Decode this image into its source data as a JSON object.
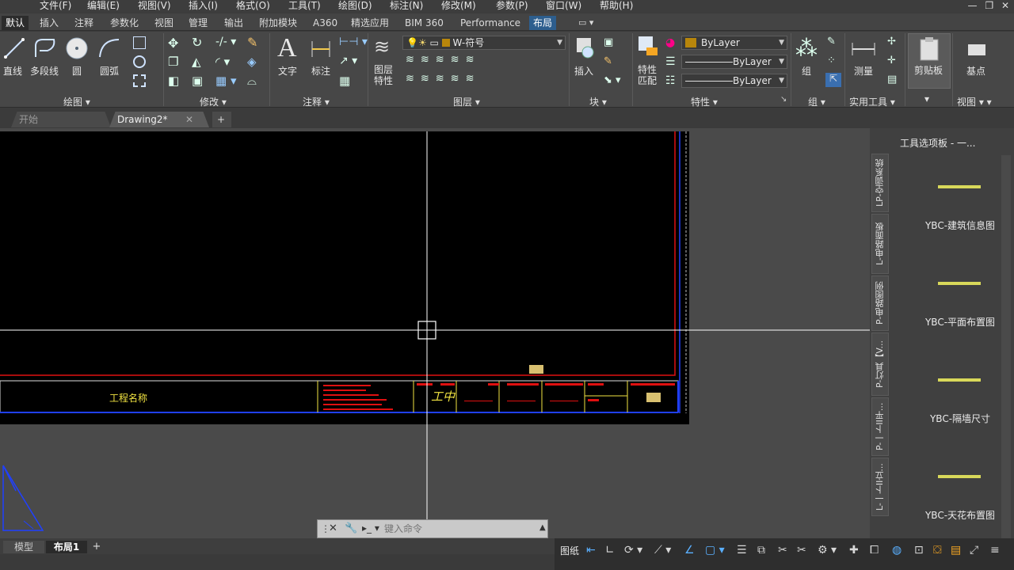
{
  "menu": {
    "items": [
      "文件(F)",
      "编辑(E)",
      "视图(V)",
      "插入(I)",
      "格式(O)",
      "工具(T)",
      "绘图(D)",
      "标注(N)",
      "修改(M)",
      "参数(P)",
      "窗口(W)",
      "帮助(H)"
    ]
  },
  "window_controls": {
    "minimize": "—",
    "restore": "❐",
    "close": "✕"
  },
  "ribbon_tabs": [
    "默认",
    "插入",
    "注释",
    "参数化",
    "视图",
    "管理",
    "输出",
    "附加模块",
    "A360",
    "精选应用",
    "BIM 360",
    "Performance",
    "布局"
  ],
  "ribbon": {
    "draw": {
      "line": "直线",
      "polyline": "多段线",
      "circle": "圆",
      "arc": "圆弧",
      "title": "绘图"
    },
    "modify": {
      "title": "修改"
    },
    "annotation": {
      "text": "文字",
      "dimension": "标注",
      "title": "注释"
    },
    "layers": {
      "properties": "图层\n特性",
      "current_layer": "W-符号",
      "title": "图层"
    },
    "block": {
      "insert": "插入",
      "title": "块"
    },
    "properties": {
      "match": "特性\n匹配",
      "color": "ByLayer",
      "linetype": "ByLayer",
      "lineweight": "ByLayer",
      "title": "特性"
    },
    "groups": {
      "group": "组",
      "title": "组"
    },
    "utilities": {
      "measure": "测量",
      "title": "实用工具"
    },
    "clipboard": {
      "paste": "剪贴板"
    },
    "view": {
      "base": "基点",
      "title": "视图"
    }
  },
  "file_tabs": {
    "start": "开始",
    "drawing": "Drawing2*",
    "add": "+"
  },
  "drawing": {
    "project_name_label": "工程名称"
  },
  "palette": {
    "title": "工具选项板 - 一...",
    "vtabs": [
      "LP-空调系统",
      "L-电路面板",
      "P-电路图例",
      "P-灯具【V...",
      "P-一卜II平...",
      "L-一卜II立..."
    ],
    "items": [
      "YBC-建筑信息图",
      "YBC-平面布置图",
      "YBC-隔墙尺寸",
      "YBC-天花布置图"
    ]
  },
  "command": {
    "placeholder": "键入命令"
  },
  "layout_tabs": {
    "model": "模型",
    "layout1": "布局1",
    "add": "+"
  },
  "status": {
    "paper": "图纸"
  }
}
